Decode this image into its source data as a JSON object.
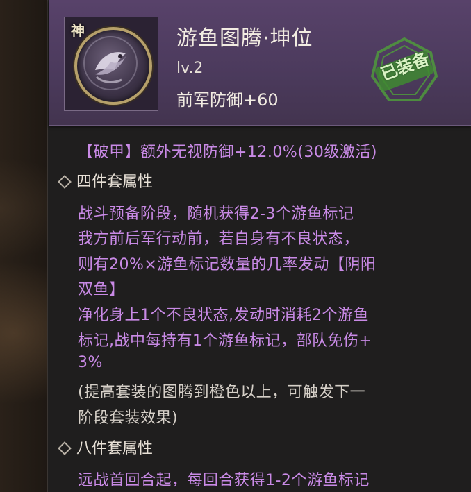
{
  "header": {
    "badge": "神",
    "title": "游鱼图腾·坤位",
    "level": "lv.2",
    "stat": "前军防御+60",
    "equipped_label": "已装备"
  },
  "effects": {
    "pojia_line": "【破甲】额外无视防御+12.0%(30级激活)"
  },
  "four_set": {
    "title": "四件套属性",
    "lines": [
      "战斗预备阶段，随机获得2-3个游鱼标记",
      "我方前后军行动前，若自身有不良状态，",
      "则有20%×游鱼标记数量的几率发动【阴阳",
      "双鱼】",
      "净化身上1个不良状态,发动时消耗2个游鱼",
      "标记,战中每持有1个游鱼标记，部队免伤+",
      "3%"
    ],
    "hint_lines": [
      "(提高套装的图腾到橙色以上，可触发下一",
      "阶段套装效果)"
    ]
  },
  "eight_set": {
    "title": "八件套属性",
    "lines": [
      "远战首回合起，每回合获得1-2个游鱼标记"
    ]
  },
  "colors": {
    "header_bg": "#4b3a5c",
    "effect_text": "#c98ae6",
    "hint_text": "#d6d0c8",
    "stamp_green": "#4f9a3c"
  }
}
